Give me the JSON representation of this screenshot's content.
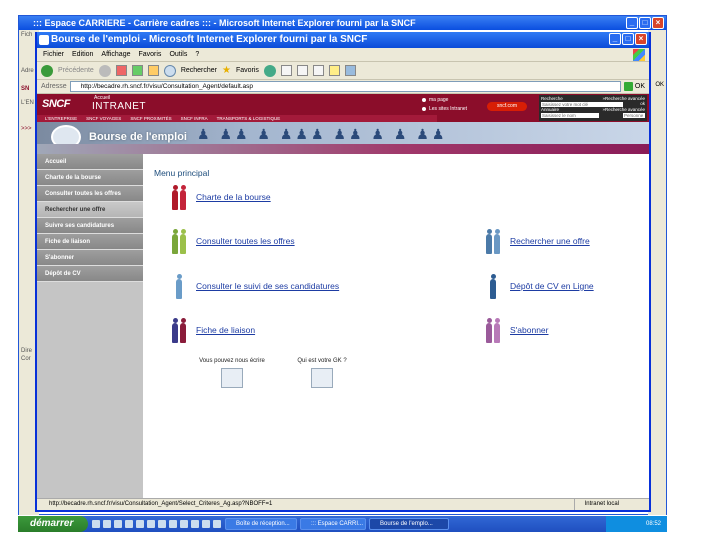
{
  "outer_window": {
    "title": "::: Espace CARRIERE - Carrière cadres ::: - Microsoft Internet Explorer fourni par la SNCF",
    "left_fragments": [
      "Fich",
      "Adre",
      "SN",
      "L'EN",
      ">>>",
      "Dire",
      "Cor"
    ],
    "right_fragments": [
      "OK"
    ]
  },
  "inner_window": {
    "title": "Bourse de l'emploi - Microsoft Internet Explorer fourni par la SNCF",
    "menu": [
      "Fichier",
      "Edition",
      "Affichage",
      "Favoris",
      "Outils",
      "?"
    ],
    "toolbar": {
      "back": "Précédente",
      "search": "Rechercher",
      "favorites": "Favoris"
    },
    "address_label": "Adresse",
    "address_url": "http://becadre.rh.sncf.fr/visu/Consultation_Agent/default.asp",
    "go_label": "OK"
  },
  "sncf_header": {
    "logo": "SNCF",
    "accueil": "Accueil",
    "intranet": "INTRANET",
    "nav": [
      "L'ENTREPRISE",
      "SNCF VOYAGES",
      "SNCF PROXIMITÉS",
      "SNCF INFRA",
      "TRANSPORTS & LOGISTIQUE"
    ],
    "links": [
      "ma page",
      "Les sites Intranet"
    ],
    "sncf_com": "sncf.com",
    "search": {
      "label": "Recherche",
      "advanced": "»Recherche avancée",
      "placeholder": "Saisissez votre mot clé",
      "go": "ok"
    },
    "annuaire": {
      "label": "Annuaire",
      "advanced": "»Recherche avancée",
      "placeholder": "Saisissez le nom",
      "select": "Personne"
    }
  },
  "banner": {
    "title": "Bourse de l'emploi"
  },
  "side_menu": [
    "Accueil",
    "Charte de la bourse",
    "Consulter toutes les offres",
    "Rechercher une offre",
    "Suivre ses candidatures",
    "Fiche de liaison",
    "S'abonner",
    "Dépôt de CV"
  ],
  "main": {
    "menu_title": "Menu principal",
    "links": {
      "charte": "Charte de la bourse",
      "consulter": "Consulter toutes les offres",
      "rechercher": "Rechercher une offre",
      "suivi": "Consulter le suivi de ses candidatures",
      "depot": "Dépôt de CV en Ligne",
      "fiche": "Fiche de liaison",
      "abonner": "S'abonner"
    },
    "write_us": "Vous pouvez nous écrire",
    "who_gk": "Qui est votre GK ?"
  },
  "status": {
    "url": "http://becadre.rh.sncf.fr/visu/Consultation_Agent/Select_Criteres_Ag.asp?NBOFF=1",
    "zone": "Intranet local"
  },
  "taskbar": {
    "start": "démarrer",
    "tasks": [
      "Boîte de réception...",
      "::: Espace CARRI...",
      "Bourse de l'emplo..."
    ],
    "clock": "08:52"
  },
  "colors": {
    "sncf_red": "#8b0d2a",
    "link_blue": "#1d3ca3",
    "title_blue": "#0b4bd8"
  }
}
